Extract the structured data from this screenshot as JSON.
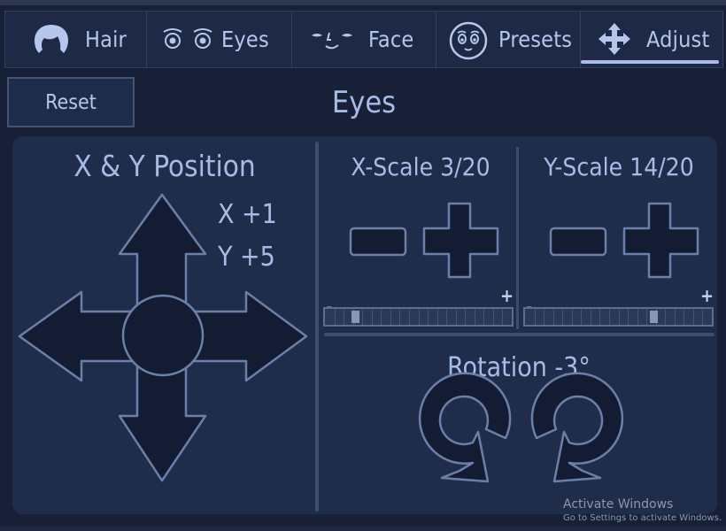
{
  "tabs": [
    {
      "label": "Hair",
      "icon": "hair-icon"
    },
    {
      "label": "Eyes",
      "icon": "eyes-icon"
    },
    {
      "label": "Face",
      "icon": "face-icon"
    },
    {
      "label": "Presets",
      "icon": "presets-icon"
    },
    {
      "label": "Adjust",
      "icon": "move-arrows-icon",
      "active": true
    }
  ],
  "reset_label": "Reset",
  "page_title": "Eyes",
  "position": {
    "title": "X & Y Position",
    "x_text": "X +1",
    "y_text": "Y +5"
  },
  "x_scale": {
    "title": "X-Scale 3/20",
    "value": 3,
    "max": 20,
    "minus_sign": "-",
    "plus_sign": "+"
  },
  "y_scale": {
    "title": "Y-Scale 14/20",
    "value": 14,
    "max": 20,
    "minus_sign": "-",
    "plus_sign": "+"
  },
  "rotation": {
    "title": "Rotation -3°"
  },
  "watermark": {
    "line1": "Activate Windows",
    "line2": "Go to Settings to activate Windows."
  },
  "colors": {
    "background": "#172036",
    "panel": "#1f2d4a",
    "control_fill": "#141c33",
    "control_stroke": "#6b80a8",
    "text": "#a6bbe6"
  }
}
